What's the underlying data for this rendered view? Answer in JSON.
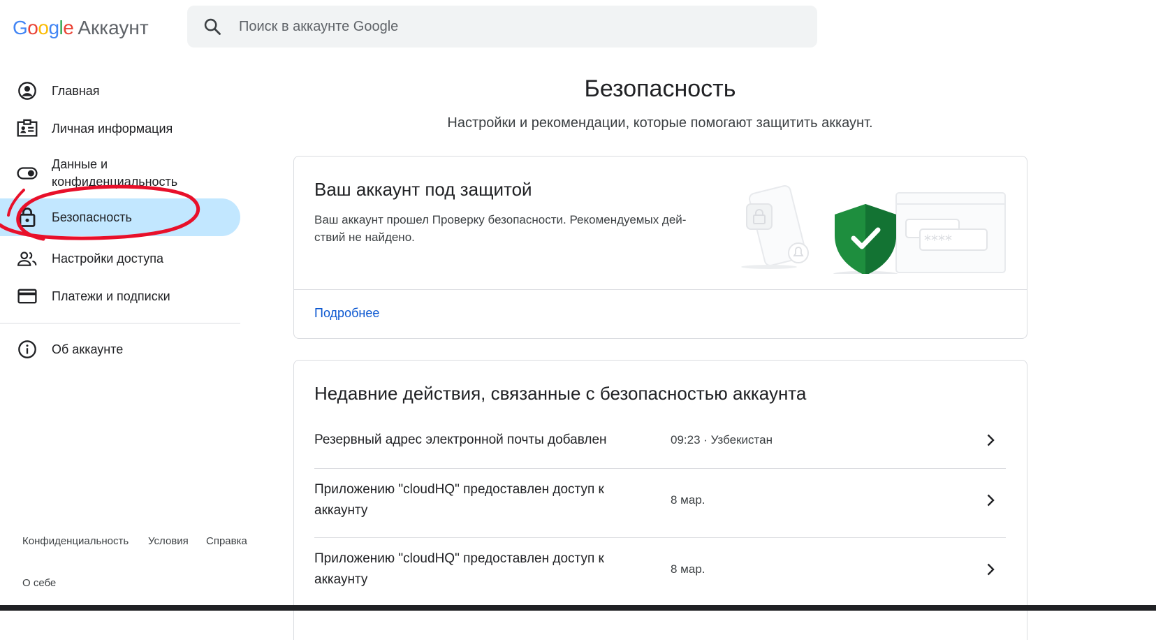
{
  "header": {
    "logo_letters": [
      {
        "ch": "G",
        "color": "#4285F4"
      },
      {
        "ch": "o",
        "color": "#EA4335"
      },
      {
        "ch": "o",
        "color": "#FBBC05"
      },
      {
        "ch": "g",
        "color": "#4285F4"
      },
      {
        "ch": "l",
        "color": "#34A853"
      },
      {
        "ch": "e",
        "color": "#EA4335"
      }
    ],
    "product": "Аккаунт",
    "search_placeholder": "Поиск в аккаунте Google"
  },
  "sidebar": {
    "items": [
      {
        "label": "Главная",
        "icon": "account-circle-icon"
      },
      {
        "label": "Личная информация",
        "icon": "id-card-icon"
      },
      {
        "label": "Данные и конфиденциальность",
        "icon": "toggle-icon"
      },
      {
        "label": "Безопасность",
        "icon": "lock-icon",
        "active": true
      },
      {
        "label": "Настройки доступа",
        "icon": "people-icon"
      },
      {
        "label": "Платежи и подписки",
        "icon": "credit-card-icon"
      },
      {
        "label": "Об аккаунте",
        "icon": "info-icon"
      }
    ],
    "annotation_color": "#e8102a"
  },
  "footer": {
    "links": [
      "Конфиденциальность",
      "Условия",
      "Справка",
      "О себе"
    ]
  },
  "main": {
    "title": "Безопасность",
    "subtitle": "Настройки и рекомендации, которые помогают защитить аккаунт.",
    "status_card": {
      "title": "Ваш аккаунт под защитой",
      "description": "Ваш аккаунт прошел Проверку безопасности. Рекомендуемых дей-ствий не найдено.",
      "link": "Подробнее",
      "password_mask": "****",
      "shield_color": "#1e8e3e"
    },
    "activity_card": {
      "title": "Недавние действия, связанные с безопасностью аккаунта",
      "rows": [
        {
          "text": "Резервный адрес электронной почты добавлен",
          "meta": "09:23 · Узбекистан"
        },
        {
          "text": "Приложению \"cloudHQ\" предоставлен доступ к аккаунту",
          "meta": "8 мар."
        },
        {
          "text": "Приложению \"cloudHQ\" предоставлен доступ к аккаунту",
          "meta": "8 мар."
        }
      ]
    }
  }
}
